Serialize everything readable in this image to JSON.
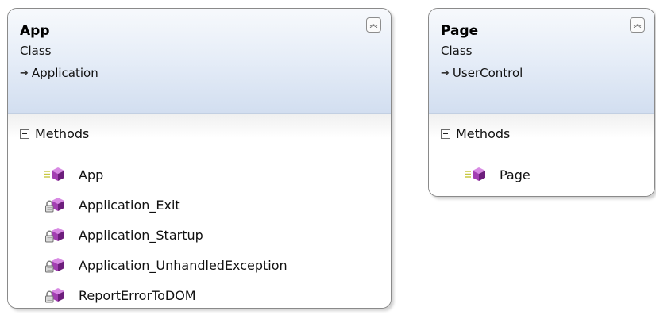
{
  "classes": [
    {
      "name": "App",
      "kind": "Class",
      "base": "Application",
      "section": "Methods",
      "methods": [
        {
          "label": "App",
          "access": "public"
        },
        {
          "label": "Application_Exit",
          "access": "private"
        },
        {
          "label": "Application_Startup",
          "access": "private"
        },
        {
          "label": "Application_UnhandledException",
          "access": "private"
        },
        {
          "label": "ReportErrorToDOM",
          "access": "private"
        }
      ]
    },
    {
      "name": "Page",
      "kind": "Class",
      "base": "UserControl",
      "section": "Methods",
      "methods": [
        {
          "label": "Page",
          "access": "public"
        }
      ]
    }
  ],
  "icons": {
    "inherit": "inherit-arrow-icon",
    "collapse": "double-chevron-up-icon",
    "section_toggle": "minus-box-icon",
    "public_method": "public-method-icon",
    "private_method": "private-method-icon"
  },
  "colors": {
    "header_top": "#f7f9fc",
    "header_bottom": "#d2def0",
    "method_cube": "#a33fb2",
    "border": "#8a8a8a"
  }
}
